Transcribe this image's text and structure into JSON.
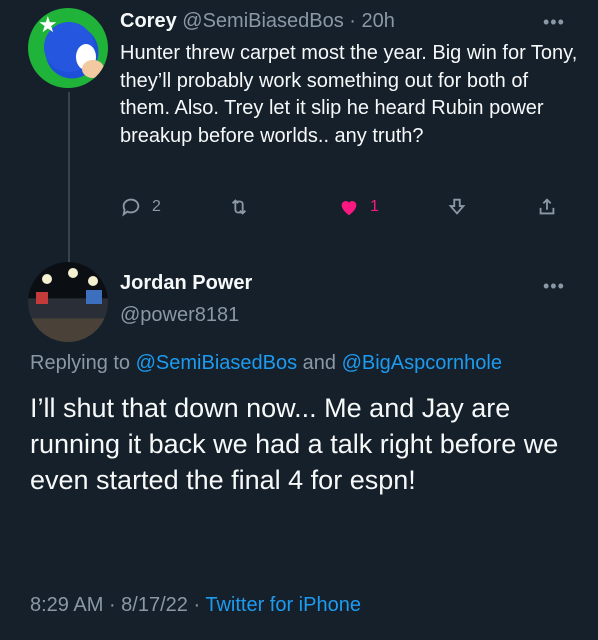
{
  "tweet1": {
    "name": "Corey",
    "handle": "@SemiBiasedBos",
    "separator": " · ",
    "time": "20h",
    "more": "•••",
    "text": "Hunter threw carpet most the year. Big win for Tony, they’ll probably work something out for both of them. Also. Trey let it slip he heard Rubin power breakup before worlds.. any truth?",
    "actions": {
      "reply_count": "2",
      "like_count": "1"
    },
    "colors": {
      "like": "#f91880",
      "muted": "#8b98a5",
      "link": "#1d9bf0"
    }
  },
  "tweet2": {
    "name": "Jordan Power",
    "handle": "@power8181",
    "more": "•••",
    "replying_prefix": "Replying to ",
    "reply_to_1": "@SemiBiasedBos",
    "reply_and": " and ",
    "reply_to_2": "@BigAspcornhole",
    "text": "I’ll shut that down now... Me and Jay are running it back we had a talk right before we even started the final 4 for espn!",
    "time": "8:29 AM",
    "dot1": " · ",
    "date": "8/17/22",
    "dot2": " · ",
    "source": "Twitter for iPhone"
  },
  "icons": [
    "reply-icon",
    "retweet-icon",
    "like-icon",
    "download-icon",
    "share-icon"
  ]
}
